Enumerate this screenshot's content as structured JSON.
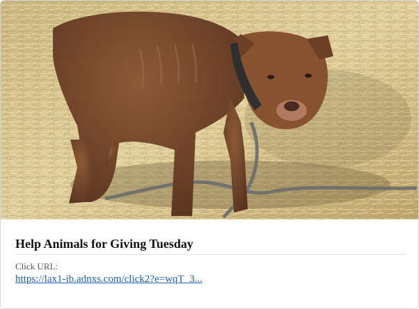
{
  "ad": {
    "image_subject": "brown-dog-on-straw-photo",
    "title": "Help Animals for Giving Tuesday",
    "click_label": "Click URL:",
    "click_url": "https://lax1-ib.adnxs.com/click2?e=wqT_3..."
  },
  "colors": {
    "link": "#1a5fb4",
    "title": "#111111",
    "straw": "#d9c48a",
    "dog": "#7a4a2e"
  }
}
